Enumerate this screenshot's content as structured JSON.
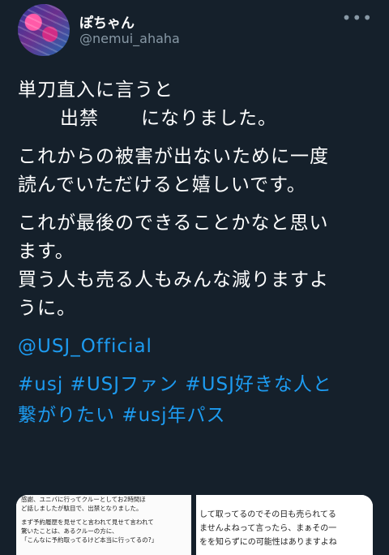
{
  "author": {
    "display_name": "ぽちゃん",
    "handle": "@nemui_ahaha",
    "more_icon": "more-horizontal-icon"
  },
  "tweet": {
    "line1": "単刀直入に言うと",
    "line2a": "出禁",
    "line2b": "になりました。",
    "line3": "これからの被害が出ないために一度",
    "line4": "読んでいただけると嬉しいです。",
    "line5": "これが最後のできることかなと思い",
    "line6": "ます。",
    "line7": "買う人も売る人もみんな減りますよ",
    "line8": "うに。",
    "mention": "@USJ_Official",
    "tags_line1": [
      "#usj",
      "#USJファン",
      "#USJ好きな人と"
    ],
    "tags_line2": [
      "繋がりたい",
      "#usj年パス"
    ]
  },
  "media": {
    "left_lines": [
      "感謝、ユニバに行ってクルーとしてお2時間ほ",
      "ど話しましたが駄目で、出禁となりました。",
      "まず予約履歴を見せてと言われて見せて言われて",
      "驚いたことは、あるクルーの方に、",
      "「こんなに予約取ってるけど本当に行ってるの?」"
    ],
    "right_lines": [
      "して取ってるのでその日も売られてる",
      "ませんよねって言ったら、まぁその一",
      "をを知らずにの可能性はありますよね"
    ]
  }
}
